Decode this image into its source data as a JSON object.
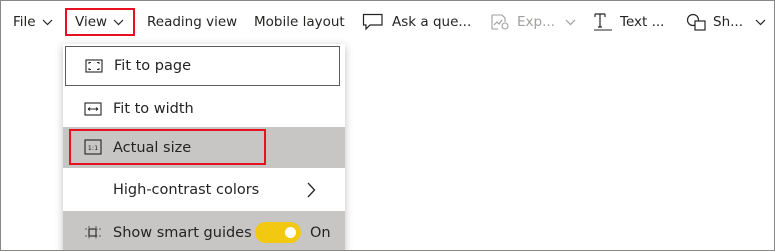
{
  "toolbar": {
    "file_label": "File",
    "view_label": "View",
    "reading_view_label": "Reading view",
    "mobile_layout_label": "Mobile layout",
    "ask_label": "Ask a que...",
    "export_label": "Exp...",
    "text_label": "Text ...",
    "shapes_label": "Sh..."
  },
  "view_menu": {
    "items": [
      {
        "label": "Fit to page",
        "icon": "fit-to-page-icon"
      },
      {
        "label": "Fit to width",
        "icon": "fit-to-width-icon"
      },
      {
        "label": "Actual size",
        "icon": "actual-size-icon",
        "icon_text": "1:1",
        "selected": true
      },
      {
        "label": "High-contrast colors",
        "has_submenu": true
      },
      {
        "label": "Show smart guides",
        "icon": "smart-guides-icon",
        "toggle_on": true,
        "toggle_text": "On"
      }
    ]
  },
  "colors": {
    "highlight_box": "#e81123",
    "toggle_on": "#f2c811",
    "selected_row": "#c8c6c4"
  }
}
